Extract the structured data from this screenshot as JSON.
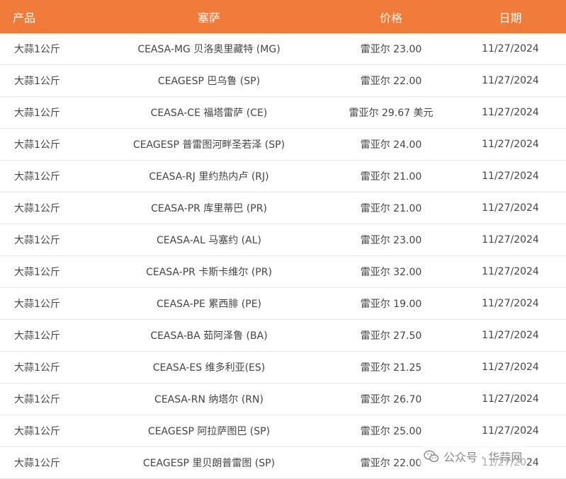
{
  "table": {
    "headers": [
      "产品",
      "塞萨",
      "价格",
      "日期"
    ],
    "rows": [
      {
        "product": "大蒜1公斤",
        "market": "CEASA-MG 贝洛奥里藏特 (MG)",
        "price": "雷亚尔 23.00",
        "date": "11/27/2024"
      },
      {
        "product": "大蒜1公斤",
        "market": "CEAGESP 巴乌鲁 (SP)",
        "price": "雷亚尔 22.00",
        "date": "11/27/2024"
      },
      {
        "product": "大蒜1公斤",
        "market": "CEASA-CE 福塔雷萨 (CE)",
        "price": "雷亚尔 29.67 美元",
        "date": "11/27/2024"
      },
      {
        "product": "大蒜1公斤",
        "market": "CEAGESP 普雷图河畔圣若泽 (SP)",
        "price": "雷亚尔 24.00",
        "date": "11/27/2024"
      },
      {
        "product": "大蒜1公斤",
        "market": "CEASA-RJ 里约热内卢 (RJ)",
        "price": "雷亚尔 21.00",
        "date": "11/27/2024"
      },
      {
        "product": "大蒜1公斤",
        "market": "CEASA-PR 库里蒂巴 (PR)",
        "price": "雷亚尔 21.00",
        "date": "11/27/2024"
      },
      {
        "product": "大蒜1公斤",
        "market": "CEASA-AL 马塞约 (AL)",
        "price": "雷亚尔 23.00",
        "date": "11/27/2024"
      },
      {
        "product": "大蒜1公斤",
        "market": "CEASA-PR 卡斯卡维尔 (PR)",
        "price": "雷亚尔 32.00",
        "date": "11/27/2024"
      },
      {
        "product": "大蒜1公斤",
        "market": "CEASA-PE 累西腓 (PE)",
        "price": "雷亚尔 19.00",
        "date": "11/27/2024"
      },
      {
        "product": "大蒜1公斤",
        "market": "CEASA-BA 茹阿泽鲁 (BA)",
        "price": "雷亚尔 27.50",
        "date": "11/27/2024"
      },
      {
        "product": "大蒜1公斤",
        "market": "CEASA-ES 维多利亚(ES)",
        "price": "雷亚尔 21.25",
        "date": "11/27/2024"
      },
      {
        "product": "大蒜1公斤",
        "market": "CEASA-RN 纳塔尔 (RN)",
        "price": "雷亚尔 26.70",
        "date": "11/27/2024"
      },
      {
        "product": "大蒜1公斤",
        "market": "CEAGESP 阿拉萨图巴 (SP)",
        "price": "雷亚尔 25.00",
        "date": "11/27/2024"
      },
      {
        "product": "大蒜1公斤",
        "market": "CEAGESP 里贝朗普雷图 (SP)",
        "price": "雷亚尔 22.00",
        "date": "11/27/2024"
      }
    ]
  },
  "watermark": {
    "text": "公众号 · 华蒜网",
    "icon": "wechat-icon"
  },
  "colors": {
    "header_bg": "#f07a38",
    "header_text": "#ffffff",
    "row_text": "#444444",
    "divider": "#e5e5e5"
  }
}
